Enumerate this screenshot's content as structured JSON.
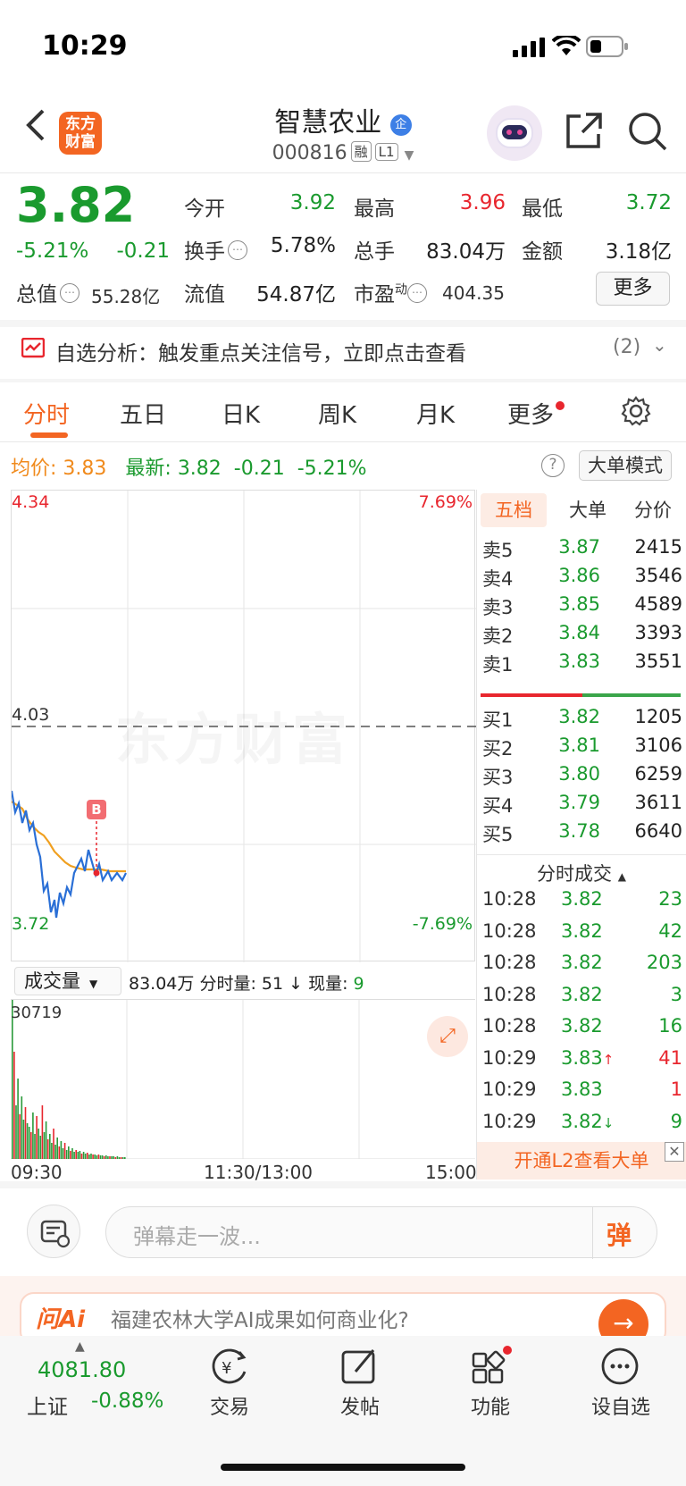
{
  "status": {
    "time": "10:29"
  },
  "header": {
    "logo_text_1": "东方",
    "logo_text_2": "财富",
    "name": "智慧农业",
    "corp_badge": "企",
    "code": "000816",
    "tag1": "融",
    "tag2": "L1"
  },
  "quote": {
    "price": "3.82",
    "pct": "-5.21%",
    "chg": "-0.21",
    "open_label": "今开",
    "open": "3.92",
    "high_label": "最高",
    "high": "3.96",
    "low_label": "最低",
    "low": "3.72",
    "turnover_label": "换手",
    "turnover": "5.78%",
    "vol_label": "总手",
    "vol": "83.04万",
    "amount_label": "金额",
    "amount": "3.18亿",
    "mcap_label": "总值",
    "mcap": "55.28亿",
    "float_label": "流值",
    "float": "54.87亿",
    "pe_label": "市盈",
    "pe_sup": "动",
    "pe": "404.35",
    "more": "更多"
  },
  "alert": {
    "text": "自选分析：触发重点关注信号，立即点击查看",
    "count": "(2)"
  },
  "tabs": [
    "分时",
    "五日",
    "日K",
    "周K",
    "月K",
    "更多"
  ],
  "info": {
    "avg_label": "均价:",
    "avg": "3.83",
    "last_label": "最新:",
    "last": "3.82",
    "chg": "-0.21",
    "pct": "-5.21%",
    "mode_btn": "大单模式"
  },
  "chart": {
    "max_price": "4.34",
    "max_pct": "7.69%",
    "mid_price": "4.03",
    "min_price": "3.72",
    "min_pct": "-7.69%",
    "marker": "B",
    "watermark": "东方财富",
    "time_start": "09:30",
    "time_mid": "11:30/13:00",
    "time_end": "15:00"
  },
  "volume": {
    "selector": "成交量",
    "total": "83.04万",
    "minute_label": "分时量:",
    "minute": "51",
    "now_label": "现量:",
    "now": "9",
    "max": "30719"
  },
  "orderbook": {
    "tabs": [
      "五档",
      "大单",
      "分价"
    ],
    "asks": [
      {
        "label": "卖5",
        "price": "3.87",
        "vol": "2415"
      },
      {
        "label": "卖4",
        "price": "3.86",
        "vol": "3546"
      },
      {
        "label": "卖3",
        "price": "3.85",
        "vol": "4589"
      },
      {
        "label": "卖2",
        "price": "3.84",
        "vol": "3393"
      },
      {
        "label": "卖1",
        "price": "3.83",
        "vol": "3551"
      }
    ],
    "bids": [
      {
        "label": "买1",
        "price": "3.82",
        "vol": "1205"
      },
      {
        "label": "买2",
        "price": "3.81",
        "vol": "3106"
      },
      {
        "label": "买3",
        "price": "3.80",
        "vol": "6259"
      },
      {
        "label": "买4",
        "price": "3.79",
        "vol": "3611"
      },
      {
        "label": "买5",
        "price": "3.78",
        "vol": "6640"
      }
    ],
    "ticks_title": "分时成交",
    "ticks": [
      {
        "time": "10:28",
        "price": "3.82",
        "vol": "23",
        "arrow": ""
      },
      {
        "time": "10:28",
        "price": "3.82",
        "vol": "42",
        "arrow": ""
      },
      {
        "time": "10:28",
        "price": "3.82",
        "vol": "203",
        "arrow": ""
      },
      {
        "time": "10:28",
        "price": "3.82",
        "vol": "3",
        "arrow": ""
      },
      {
        "time": "10:28",
        "price": "3.82",
        "vol": "16",
        "arrow": ""
      },
      {
        "time": "10:29",
        "price": "3.83",
        "vol": "41",
        "arrow": "↑"
      },
      {
        "time": "10:29",
        "price": "3.83",
        "vol": "1",
        "arrow": ""
      },
      {
        "time": "10:29",
        "price": "3.82",
        "vol": "9",
        "arrow": "↓"
      }
    ],
    "l2_banner": "开通L2查看大单"
  },
  "danmaku": {
    "placeholder": "弹幕走一波...",
    "btn": "弹"
  },
  "promo": {
    "brand": "问Ai",
    "text": "福建农林大学AI成果如何商业化?"
  },
  "nav": {
    "index_value": "4081.80",
    "index_name": "上证",
    "index_pct": "-0.88%",
    "items": [
      "交易",
      "发帖",
      "功能",
      "设自选"
    ]
  }
}
